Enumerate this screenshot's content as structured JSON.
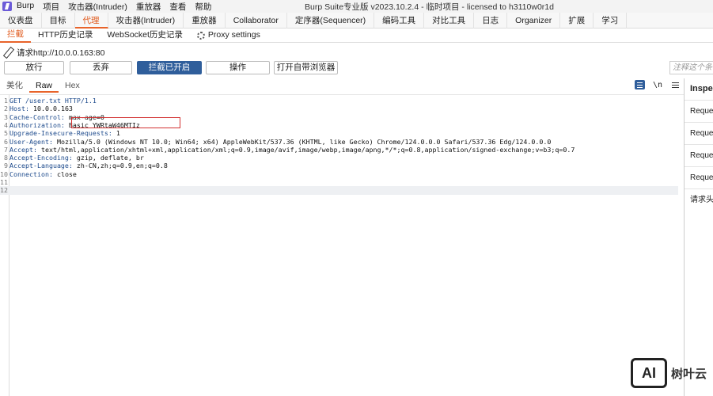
{
  "window": {
    "menu": [
      "Burp",
      "项目",
      "攻击器(Intruder)",
      "重放器",
      "查看",
      "帮助"
    ],
    "title": "Burp Suite专业版  v2023.10.2.4 - 临时项目 - licensed to h3110w0r1d"
  },
  "main_tabs": [
    {
      "label": "仪表盘",
      "active": false
    },
    {
      "label": "目标",
      "active": false
    },
    {
      "label": "代理",
      "active": true
    },
    {
      "label": "攻击器(Intruder)",
      "active": false
    },
    {
      "label": "重放器",
      "active": false
    },
    {
      "label": "Collaborator",
      "active": false
    },
    {
      "label": "定序器(Sequencer)",
      "active": false
    },
    {
      "label": "编码工具",
      "active": false
    },
    {
      "label": "对比工具",
      "active": false
    },
    {
      "label": "日志",
      "active": false
    },
    {
      "label": "Organizer",
      "active": false
    },
    {
      "label": "扩展",
      "active": false
    },
    {
      "label": "学习",
      "active": false
    }
  ],
  "sub_tabs": {
    "intercept": "拦截",
    "http_history": "HTTP历史记录",
    "websocket_history": "WebSocket历史记录",
    "proxy_settings": "Proxy settings"
  },
  "request_target": "请求http://10.0.0.163:80",
  "toolbar": {
    "forward": "放行",
    "drop": "丢弃",
    "intercept_on": "拦截已开启",
    "action": "操作",
    "open_browser": "打开自带浏览器",
    "note": "注释这个条目"
  },
  "editor_tabs": {
    "pretty": "美化",
    "raw": "Raw",
    "hex": "Hex",
    "newline_toggle": "\\n"
  },
  "request_lines": [
    {
      "n": "1",
      "key": "GET /user.txt HTTP/1.1",
      "value": ""
    },
    {
      "n": "2",
      "key": "Host:",
      "value": " 10.0.0.163"
    },
    {
      "n": "3",
      "key": "Cache-Control:",
      "value": " max-age=0"
    },
    {
      "n": "4",
      "key": "Authorization:",
      "value": " Basic YWRtaW46MTIz"
    },
    {
      "n": "5",
      "key": "Upgrade-Insecure-Requests:",
      "value": " 1"
    },
    {
      "n": "6",
      "key": "User-Agent:",
      "value": " Mozilla/5.0 (Windows NT 10.0; Win64; x64) AppleWebKit/537.36 (KHTML, like Gecko) Chrome/124.0.0.0 Safari/537.36 Edg/124.0.0.0"
    },
    {
      "n": "7",
      "key": "Accept:",
      "value": " text/html,application/xhtml+xml,application/xml;q=0.9,image/avif,image/webp,image/apng,*/*;q=0.8,application/signed-exchange;v=b3;q=0.7"
    },
    {
      "n": "8",
      "key": "Accept-Encoding:",
      "value": " gzip, deflate, br"
    },
    {
      "n": "9",
      "key": "Accept-Language:",
      "value": " zh-CN,zh;q=0.9,en;q=0.8"
    },
    {
      "n": "10",
      "key": "Connection:",
      "value": " close"
    },
    {
      "n": "11",
      "key": "",
      "value": ""
    },
    {
      "n": "12",
      "key": "",
      "value": ""
    }
  ],
  "inspector": {
    "title": "Inspector",
    "items": [
      "Request attributes",
      "Request query parameters",
      "Request body parameters",
      "Request cookies",
      "请求头"
    ]
  },
  "watermark": {
    "logo_text": "AI",
    "text": "树叶云"
  }
}
